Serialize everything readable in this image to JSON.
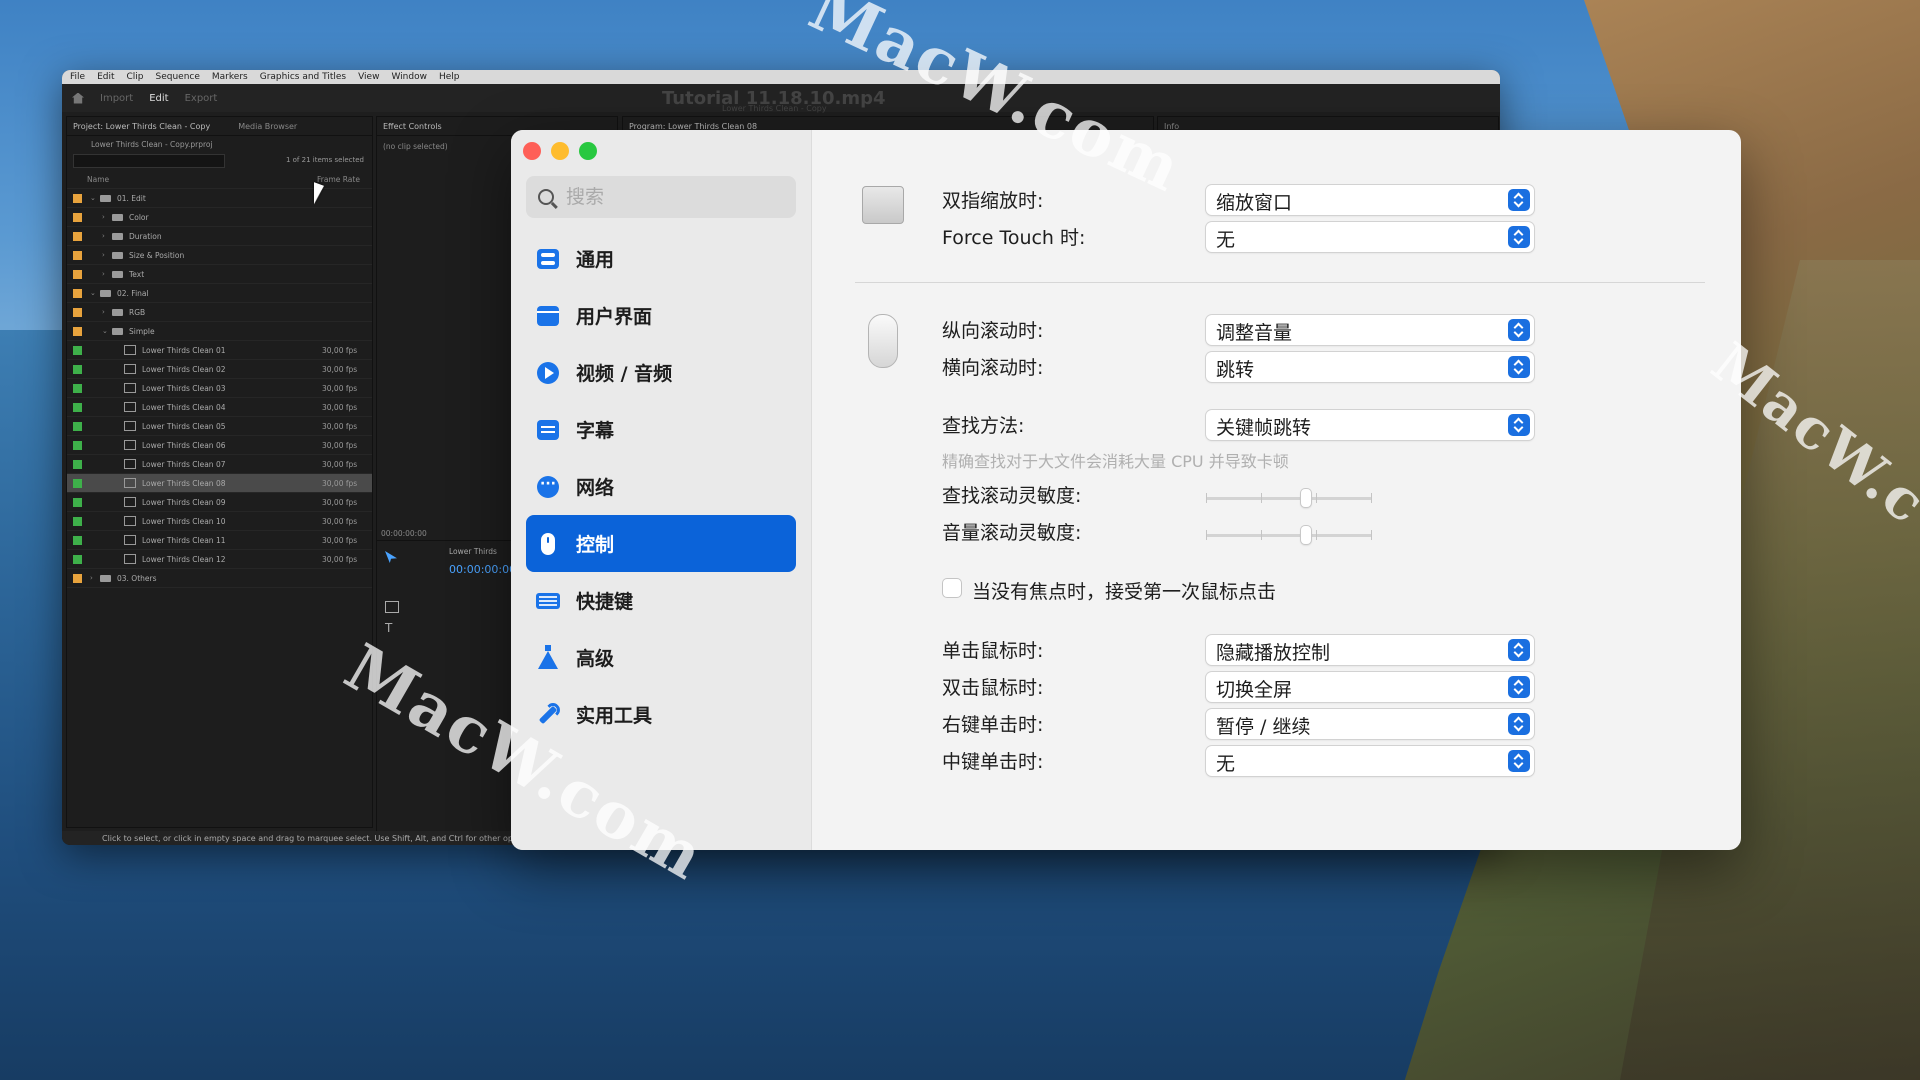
{
  "premiere": {
    "menu": [
      "File",
      "Edit",
      "Clip",
      "Sequence",
      "Markers",
      "Graphics and Titles",
      "View",
      "Window",
      "Help"
    ],
    "workspaces": [
      "Import",
      "Edit",
      "Export"
    ],
    "title": "Tutorial 11.18.10.mp4",
    "subtitle": "Lower Thirds Clean - Copy",
    "project_tab": "Project: Lower Thirds Clean - Copy",
    "media_browser_tab": "Media Browser",
    "effect_controls_tab": "Effect Controls",
    "program_tab": "Program: Lower Thirds Clean 08",
    "info_tab": "Info",
    "project_file": "Lower Thirds Clean - Copy.prproj",
    "items_selected": "1 of 21 items selected",
    "col_name": "Name",
    "col_frame_rate": "Frame Rate",
    "no_clip": "(no clip selected)",
    "timecode": "00:00:00:00",
    "timeline_title": "Lower Thirds",
    "status_text": "Click to select, or click in empty space and drag to marquee select. Use Shift, Alt, and Ctrl for other options.",
    "rows": [
      {
        "name": "01. Edit",
        "fps": "",
        "indent": 0,
        "type": "folder",
        "color": "#e8a33d",
        "open": true
      },
      {
        "name": "Color",
        "fps": "",
        "indent": 1,
        "type": "folder",
        "color": "#e8a33d",
        "open": false
      },
      {
        "name": "Duration",
        "fps": "",
        "indent": 1,
        "type": "folder",
        "color": "#e8a33d",
        "open": false
      },
      {
        "name": "Size & Position",
        "fps": "",
        "indent": 1,
        "type": "folder",
        "color": "#e8a33d",
        "open": false
      },
      {
        "name": "Text",
        "fps": "",
        "indent": 1,
        "type": "folder",
        "color": "#e8a33d",
        "open": false
      },
      {
        "name": "02. Final",
        "fps": "",
        "indent": 0,
        "type": "folder",
        "color": "#e8a33d",
        "open": true
      },
      {
        "name": "RGB",
        "fps": "",
        "indent": 1,
        "type": "folder",
        "color": "#e8a33d",
        "open": false
      },
      {
        "name": "Simple",
        "fps": "",
        "indent": 1,
        "type": "folder",
        "color": "#e8a33d",
        "open": true
      },
      {
        "name": "Lower Thirds Clean 01",
        "fps": "30,00 fps",
        "indent": 2,
        "type": "seq",
        "color": "#3eb04a"
      },
      {
        "name": "Lower Thirds Clean 02",
        "fps": "30,00 fps",
        "indent": 2,
        "type": "seq",
        "color": "#3eb04a"
      },
      {
        "name": "Lower Thirds Clean 03",
        "fps": "30,00 fps",
        "indent": 2,
        "type": "seq",
        "color": "#3eb04a"
      },
      {
        "name": "Lower Thirds Clean 04",
        "fps": "30,00 fps",
        "indent": 2,
        "type": "seq",
        "color": "#3eb04a"
      },
      {
        "name": "Lower Thirds Clean 05",
        "fps": "30,00 fps",
        "indent": 2,
        "type": "seq",
        "color": "#3eb04a"
      },
      {
        "name": "Lower Thirds Clean 06",
        "fps": "30,00 fps",
        "indent": 2,
        "type": "seq",
        "color": "#3eb04a"
      },
      {
        "name": "Lower Thirds Clean 07",
        "fps": "30,00 fps",
        "indent": 2,
        "type": "seq",
        "color": "#3eb04a"
      },
      {
        "name": "Lower Thirds Clean 08",
        "fps": "30,00 fps",
        "indent": 2,
        "type": "seq",
        "color": "#3eb04a",
        "selected": true
      },
      {
        "name": "Lower Thirds Clean 09",
        "fps": "30,00 fps",
        "indent": 2,
        "type": "seq",
        "color": "#3eb04a"
      },
      {
        "name": "Lower Thirds Clean 10",
        "fps": "30,00 fps",
        "indent": 2,
        "type": "seq",
        "color": "#3eb04a"
      },
      {
        "name": "Lower Thirds Clean 11",
        "fps": "30,00 fps",
        "indent": 2,
        "type": "seq",
        "color": "#3eb04a"
      },
      {
        "name": "Lower Thirds Clean 12",
        "fps": "30,00 fps",
        "indent": 2,
        "type": "seq",
        "color": "#3eb04a"
      },
      {
        "name": "03. Others",
        "fps": "",
        "indent": 0,
        "type": "folder",
        "color": "#e8a33d",
        "open": false
      }
    ]
  },
  "prefs": {
    "traffic_colors": {
      "close": "#fe5f57",
      "minimize": "#febc2e",
      "zoom": "#28c840"
    },
    "accent": "#0b63d9",
    "search": {
      "placeholder": "搜索"
    },
    "nav": [
      {
        "label": "通用",
        "icon": "toggle-icon",
        "active": false
      },
      {
        "label": "用户界面",
        "icon": "window-icon",
        "active": false
      },
      {
        "label": "视频 / 音频",
        "icon": "play-icon",
        "active": false
      },
      {
        "label": "字幕",
        "icon": "subtitle-icon",
        "active": false
      },
      {
        "label": "网络",
        "icon": "network-icon",
        "active": false
      },
      {
        "label": "控制",
        "icon": "mouse-icon",
        "active": true
      },
      {
        "label": "快捷键",
        "icon": "keyboard-icon",
        "active": false
      },
      {
        "label": "高级",
        "icon": "flask-icon",
        "active": false
      },
      {
        "label": "实用工具",
        "icon": "wrench-icon",
        "active": false
      }
    ],
    "trackpad": {
      "pinch_label": "双指缩放时:",
      "pinch_value": "缩放窗口",
      "force_touch_label": "Force Touch 时:",
      "force_touch_value": "无"
    },
    "mouse": {
      "vscroll_label": "纵向滚动时:",
      "vscroll_value": "调整音量",
      "hscroll_label": "横向滚动时:",
      "hscroll_value": "跳转",
      "seek_method_label": "查找方法:",
      "seek_method_value": "关键帧跳转",
      "seek_hint": "精确查找对于大文件会消耗大量 CPU 并导致卡顿",
      "seek_sens_label": "查找滚动灵敏度:",
      "seek_sens_value": 0.6,
      "vol_sens_label": "音量滚动灵敏度:",
      "vol_sens_value": 0.6,
      "first_click_label": "当没有焦点时，接受第一次鼠标点击",
      "first_click_checked": false
    },
    "clicks": {
      "single_label": "单击鼠标时:",
      "single_value": "隐藏播放控制",
      "double_label": "双击鼠标时:",
      "double_value": "切换全屏",
      "right_label": "右键单击时:",
      "right_value": "暂停 / 继续",
      "middle_label": "中键单击时:",
      "middle_value": "无"
    }
  }
}
